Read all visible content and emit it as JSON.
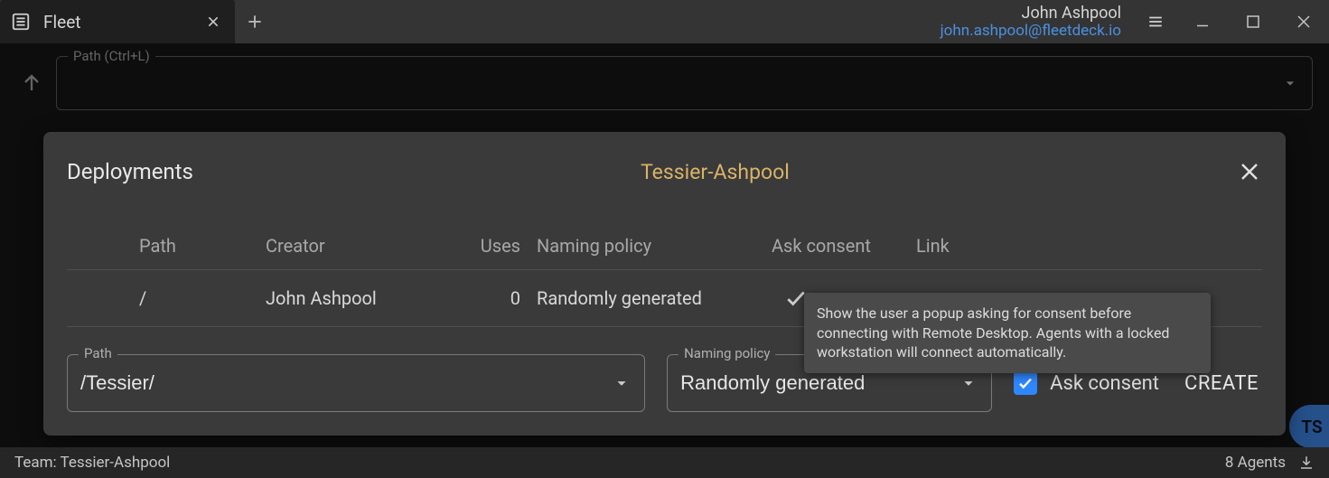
{
  "titlebar": {
    "tab_label": "Fleet",
    "user_name": "John Ashpool",
    "user_email": "john.ashpool@fleetdeck.io"
  },
  "path_bar": {
    "legend": "Path (Ctrl+L)",
    "value": ""
  },
  "status": {
    "team_label": "Team: Tessier-Ashpool",
    "agents_label": "8 Agents"
  },
  "modal": {
    "title": "Deployments",
    "team": "Tessier-Ashpool",
    "columns": {
      "path": "Path",
      "creator": "Creator",
      "uses": "Uses",
      "naming": "Naming policy",
      "consent": "Ask consent",
      "link": "Link"
    },
    "rows": [
      {
        "path": "/",
        "creator": "John Ashpool",
        "uses": "0",
        "naming": "Randomly generated",
        "consent_checked": true
      }
    ],
    "tooltip": "Show the user a popup asking for consent before connecting with Remote Desktop. Agents with a locked workstation will connect automatically.",
    "form": {
      "path_legend": "Path",
      "path_value": "/Tessier/",
      "naming_legend": "Naming policy",
      "naming_value": "Randomly generated",
      "ask_consent_label": "Ask consent",
      "ask_consent_checked": true,
      "create_label": "CREATE"
    }
  },
  "peek_button": "TS"
}
